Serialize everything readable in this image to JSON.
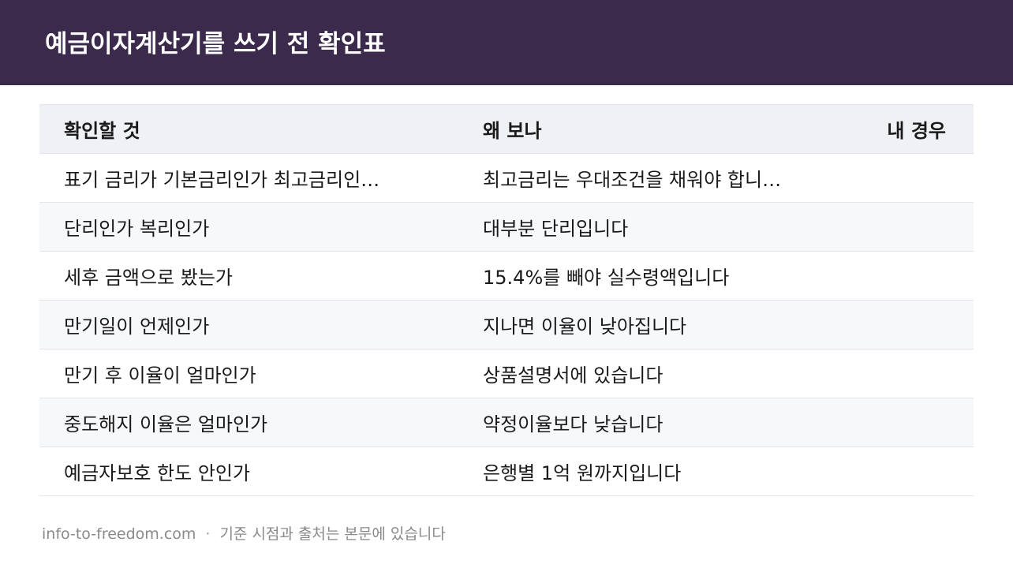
{
  "header": {
    "title": "예금이자계산기를 쓰기 전 확인표"
  },
  "table": {
    "columns": [
      "확인할 것",
      "왜 보나",
      "내 경우"
    ],
    "rows": [
      {
        "item": "표기 금리가 기본금리인가 최고금리인…",
        "reason": "최고금리는 우대조건을 채워야 합니…",
        "mine": ""
      },
      {
        "item": "단리인가 복리인가",
        "reason": "대부분 단리입니다",
        "mine": ""
      },
      {
        "item": "세후 금액으로 봤는가",
        "reason": "15.4%를 빼야 실수령액입니다",
        "mine": ""
      },
      {
        "item": "만기일이 언제인가",
        "reason": "지나면 이율이 낮아집니다",
        "mine": ""
      },
      {
        "item": "만기 후 이율이 얼마인가",
        "reason": "상품설명서에 있습니다",
        "mine": ""
      },
      {
        "item": "중도해지 이율은 얼마인가",
        "reason": "약정이율보다 낮습니다",
        "mine": ""
      },
      {
        "item": "예금자보호 한도 안인가",
        "reason": "은행별 1억 원까지입니다",
        "mine": ""
      }
    ]
  },
  "footer": {
    "site": "info-to-freedom.com",
    "separator": "·",
    "note": "기준 시점과 출처는 본문에 있습니다"
  },
  "colors": {
    "header_bg": "#3c2a4d",
    "table_head_bg": "#eff1f5",
    "row_alt_bg": "#f7f8fa"
  }
}
